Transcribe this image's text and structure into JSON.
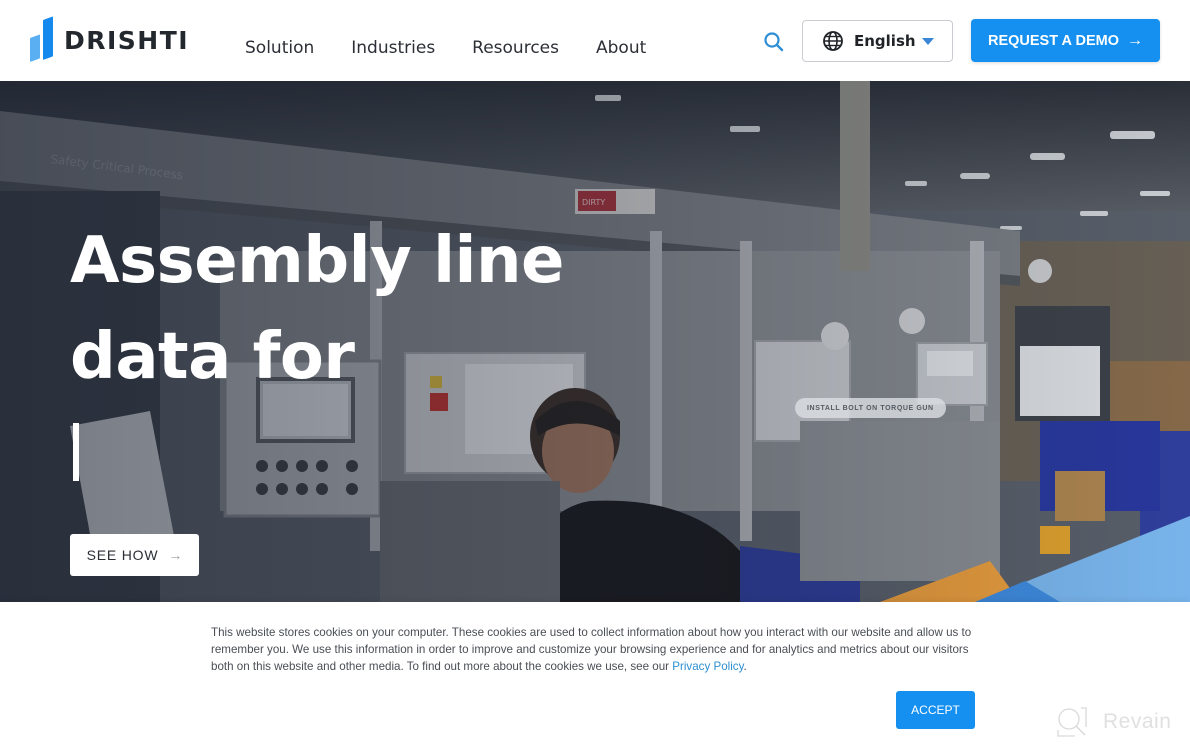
{
  "header": {
    "logo_text": "DRISHTI",
    "nav": [
      {
        "label": "Solution"
      },
      {
        "label": "Industries"
      },
      {
        "label": "Resources"
      },
      {
        "label": "About"
      }
    ],
    "search_icon": "search-icon",
    "language": {
      "selected": "English",
      "icon": "globe-icon"
    },
    "demo_button": {
      "label": "REQUEST A DEMO",
      "icon": "arrow-right-icon"
    }
  },
  "hero": {
    "title_lines": [
      "Assembly line",
      "data for"
    ],
    "see_how_label": "SEE HOW",
    "photo_labels": {
      "banner": "Safety Critical Process",
      "sign": "DIRTY",
      "station_tag": "INSTALL BOLT ON TORQUE GUN"
    }
  },
  "cookie_banner": {
    "text": "This website stores cookies on your computer. These cookies are used to collect information about how you interact with our website and allow us to remember you. We use this information in order to improve and customize your browsing experience and for analytics and metrics about our visitors both on this website and other media. To find out more about the cookies we use, see our ",
    "policy_link": "Privacy Policy",
    "text_end": ".",
    "accept_label": "ACCEPT"
  },
  "watermark": {
    "text": "Revain"
  },
  "colors": {
    "brand_blue": "#1590f0",
    "logo_light": "#5aaef2",
    "accent_orange": "#f2a23c",
    "accent_light_blue": "#7dbcf5",
    "link": "#2d8fcf"
  }
}
